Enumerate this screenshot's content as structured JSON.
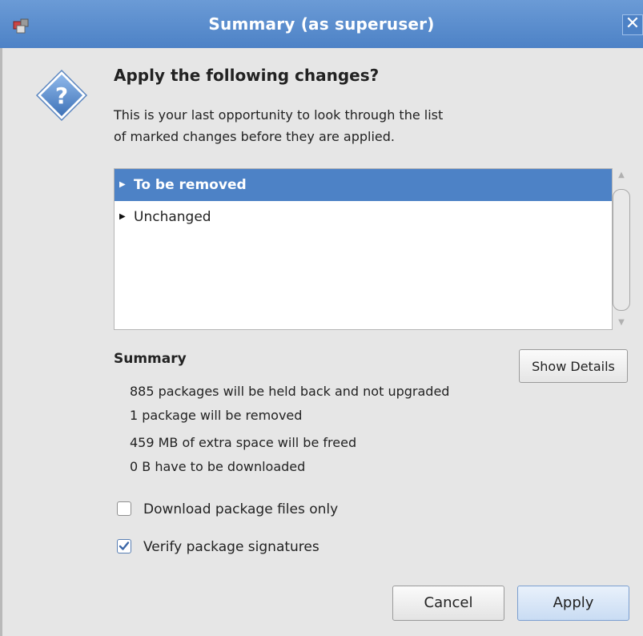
{
  "window": {
    "title": "Summary (as superuser)",
    "close_glyph": "✕",
    "app_icon": "synaptic-package-icon"
  },
  "dialog": {
    "icon": "question-icon",
    "heading": "Apply the following changes?",
    "intro_line1": "This is your last opportunity to look through the list",
    "intro_line2": "of marked changes before they are applied."
  },
  "changes_tree": {
    "items": [
      {
        "label": "To be removed",
        "selected": true,
        "expanded": false
      },
      {
        "label": "Unchanged",
        "selected": false,
        "expanded": false
      }
    ]
  },
  "summary": {
    "title": "Summary",
    "show_details_label": "Show Details",
    "line1": "885 packages will be held back and not upgraded",
    "line2": "1 package will be removed",
    "line3": "459 MB of extra space will be freed",
    "line4": "0  B have to be downloaded"
  },
  "options": {
    "download_only": {
      "label": "Download package files only",
      "checked": false
    },
    "verify_signatures": {
      "label": "Verify package signatures",
      "checked": true
    }
  },
  "buttons": {
    "cancel": "Cancel",
    "apply": "Apply"
  },
  "colors": {
    "accent": "#4d82c6",
    "titlebar_top": "#6b9bd6",
    "background": "#e6e6e6"
  }
}
